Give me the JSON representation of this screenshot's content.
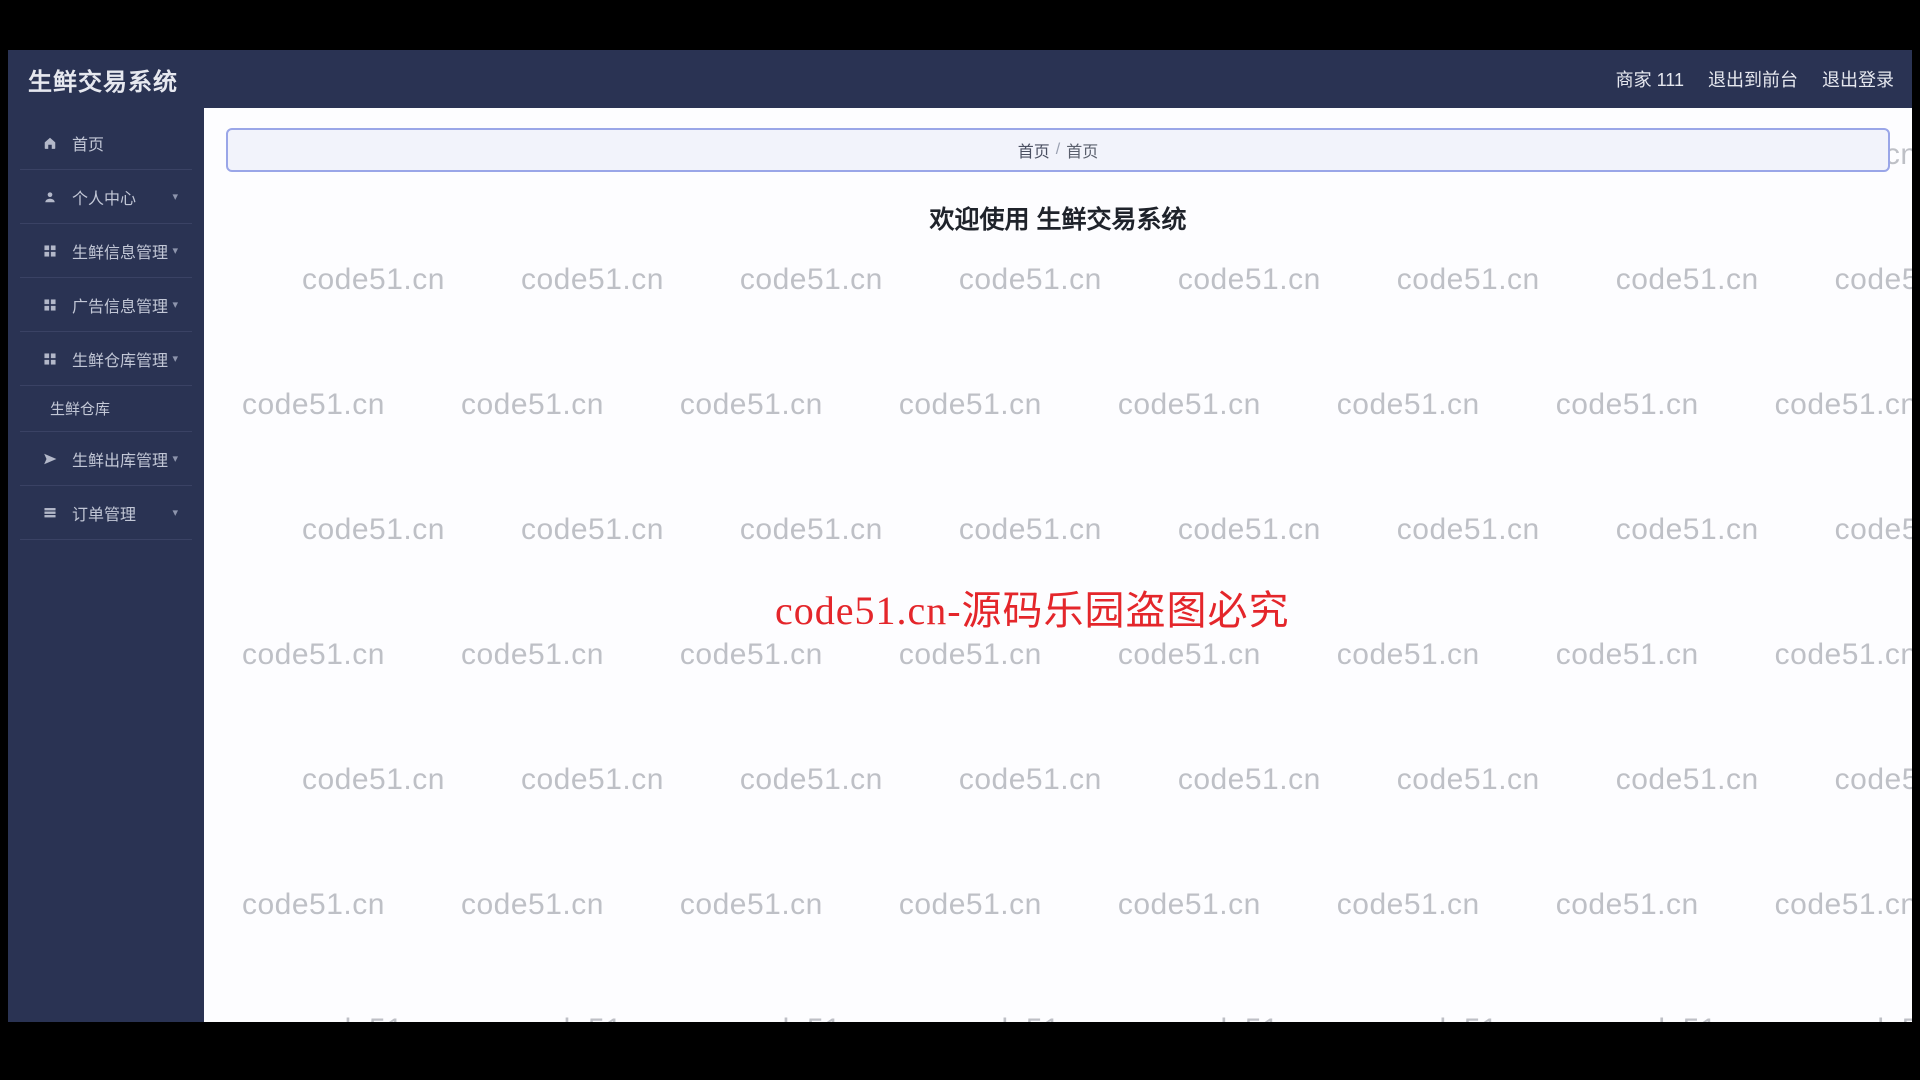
{
  "app": {
    "title": "生鲜交易系统"
  },
  "header": {
    "merchant": "商家 111",
    "frontend_exit": "退出到前台",
    "logout": "退出登录"
  },
  "sidebar": {
    "items": [
      {
        "icon": "home-icon",
        "label": "首页",
        "expandable": false
      },
      {
        "icon": "user-icon",
        "label": "个人中心",
        "expandable": true
      },
      {
        "icon": "grid-icon",
        "label": "生鲜信息管理",
        "expandable": true
      },
      {
        "icon": "grid-icon",
        "label": "广告信息管理",
        "expandable": true
      },
      {
        "icon": "grid-icon",
        "label": "生鲜仓库管理",
        "expandable": true,
        "expanded": true,
        "children": [
          {
            "label": "生鲜仓库"
          }
        ]
      },
      {
        "icon": "send-icon",
        "label": "生鲜出库管理",
        "expandable": true
      },
      {
        "icon": "list-icon",
        "label": "订单管理",
        "expandable": true
      }
    ]
  },
  "breadcrumb": {
    "root": "首页",
    "current": "首页"
  },
  "main": {
    "welcome": "欢迎使用 生鲜交易系统"
  },
  "watermark": {
    "text": "code51.cn",
    "center_banner": "code51.cn-源码乐园盗图必究"
  }
}
